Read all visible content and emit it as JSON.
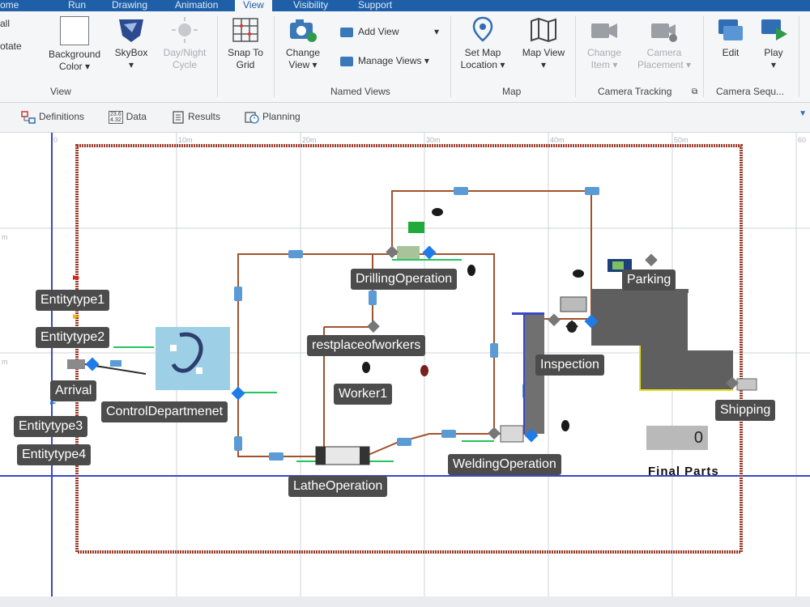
{
  "ribbon_tabs": [
    "ome",
    "Run",
    "Drawing",
    "Animation",
    "View",
    "Visibility",
    "Support"
  ],
  "ribbon_partial": [
    "all",
    "otate"
  ],
  "view_group": {
    "background_color": "Background Color",
    "skybox": "SkyBox",
    "day_night": "Day/Night Cycle",
    "label": "View"
  },
  "snap_to_grid": "Snap To Grid",
  "named_views": {
    "change_view": "Change View",
    "add_view": "Add View",
    "manage_views": "Manage Views",
    "label": "Named Views"
  },
  "map_group": {
    "set_map_location": "Set Map Location",
    "map_view": "Map View",
    "label": "Map"
  },
  "camera_tracking": {
    "change_item": "Change Item",
    "camera_placement": "Camera Placement",
    "label": "Camera Tracking"
  },
  "camera_sequence": {
    "edit": "Edit",
    "play": "Play",
    "label": "Camera Sequ..."
  },
  "subtabs": [
    "Definitions",
    "Data",
    "Results",
    "Planning"
  ],
  "data_icon_text": [
    "23.6",
    "4.32"
  ],
  "ruler": [
    "0",
    "10m",
    "20m",
    "30m",
    "40m",
    "50m",
    "60"
  ],
  "ruler_side": [
    "m",
    "m"
  ],
  "objects": {
    "entitytype1": "Entitytype1",
    "entitytype2": "Entitytype2",
    "arrival": "Arrival",
    "entitytype3": "Entitytype3",
    "entitytype4": "Entitytype4",
    "control_department": "ControlDepartmenet",
    "drilling": "DrillingOperation",
    "restplace": "restplaceofworkers",
    "worker1": "Worker1",
    "lathe": "LatheOperation",
    "welding": "WeldingOperation",
    "inspection": "Inspection",
    "parking": "Parking",
    "shipping": "Shipping"
  },
  "counter_value": "0",
  "final_parts": "Final Parts",
  "colors": {
    "ribbon_blue": "#1e5fa8",
    "path_brown": "#a0522d",
    "border_red": "#9b3b2a",
    "node_blue": "#1f7be8",
    "label_bg": "#4c4c4c"
  }
}
